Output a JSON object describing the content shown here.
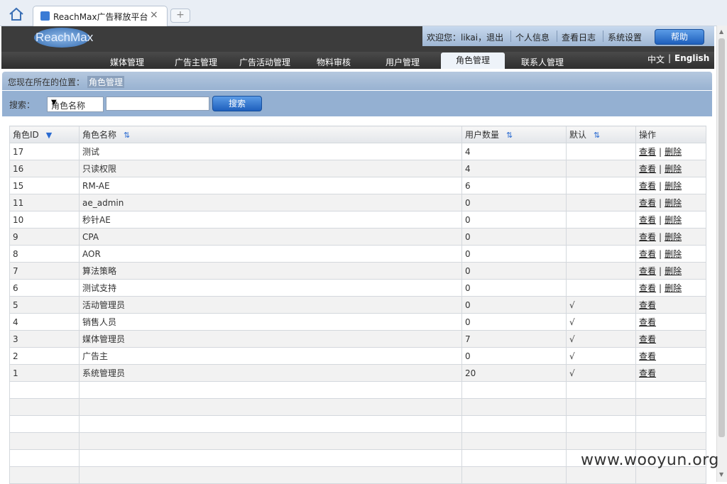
{
  "browser": {
    "tab_title": "ReachMax广告释放平台",
    "tab_close": "×",
    "new_tab": "+"
  },
  "header": {
    "logo_text": "ReachMax",
    "welcome": "欢迎您：likai，退出",
    "links": [
      "个人信息",
      "查看日志",
      "系统设置"
    ],
    "help": "帮助"
  },
  "nav": {
    "items": [
      "媒体管理",
      "广告主管理",
      "广告活动管理",
      "物料审核",
      "用户管理",
      "角色管理",
      "联系人管理"
    ],
    "active": "角色管理",
    "lang_zh": "中文",
    "lang_sep": "|",
    "lang_en": "English"
  },
  "breadcrumb": {
    "label": "您现在所在的位置：",
    "current": "角色管理"
  },
  "search": {
    "label": "搜索：",
    "field_selected": "角色名称",
    "input_value": "",
    "button": "搜索"
  },
  "table": {
    "headers": [
      "角色ID",
      "角色名称",
      "用户数量",
      "默认",
      "操作"
    ],
    "view_label": "查看",
    "delete_label": "删除",
    "rows": [
      {
        "id": "17",
        "name": "测试",
        "users": "4",
        "default": "",
        "actions": [
          "查看",
          "删除"
        ]
      },
      {
        "id": "16",
        "name": "只读权限",
        "users": "4",
        "default": "",
        "actions": [
          "查看",
          "删除"
        ]
      },
      {
        "id": "15",
        "name": "RM-AE",
        "users": "6",
        "default": "",
        "actions": [
          "查看",
          "删除"
        ]
      },
      {
        "id": "11",
        "name": "ae_admin",
        "users": "0",
        "default": "",
        "actions": [
          "查看",
          "删除"
        ]
      },
      {
        "id": "10",
        "name": "秒针AE",
        "users": "0",
        "default": "",
        "actions": [
          "查看",
          "删除"
        ]
      },
      {
        "id": "9",
        "name": "CPA",
        "users": "0",
        "default": "",
        "actions": [
          "查看",
          "删除"
        ]
      },
      {
        "id": "8",
        "name": "AOR",
        "users": "0",
        "default": "",
        "actions": [
          "查看",
          "删除"
        ]
      },
      {
        "id": "7",
        "name": "算法策略",
        "users": "0",
        "default": "",
        "actions": [
          "查看",
          "删除"
        ]
      },
      {
        "id": "6",
        "name": "测试支持",
        "users": "0",
        "default": "",
        "actions": [
          "查看",
          "删除"
        ]
      },
      {
        "id": "5",
        "name": "活动管理员",
        "users": "0",
        "default": "√",
        "actions": [
          "查看"
        ]
      },
      {
        "id": "4",
        "name": "销售人员",
        "users": "0",
        "default": "√",
        "actions": [
          "查看"
        ]
      },
      {
        "id": "3",
        "name": "媒体管理员",
        "users": "7",
        "default": "√",
        "actions": [
          "查看"
        ]
      },
      {
        "id": "2",
        "name": "广告主",
        "users": "0",
        "default": "√",
        "actions": [
          "查看"
        ]
      },
      {
        "id": "1",
        "name": "系统管理员",
        "users": "20",
        "default": "√",
        "actions": [
          "查看"
        ]
      }
    ],
    "empty_rows": 6
  },
  "watermark": "www.wooyun.org"
}
